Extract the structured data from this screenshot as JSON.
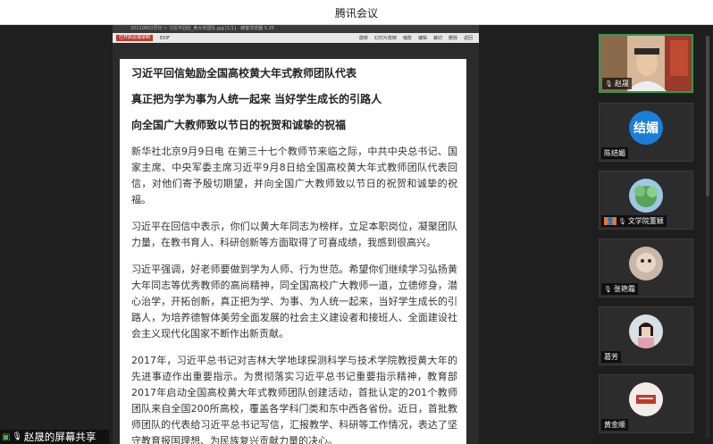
{
  "app": {
    "title": "腾讯会议"
  },
  "viewer": {
    "window_title": "20210910早日 > 习近平回信_黄大年团队.jpg [1/1] - 蜂蜜浏览器 5.35",
    "toolbar": {
      "badge": "已开启云端录制",
      "exif": "EXIF",
      "tools": [
        "旋转",
        "幻灯片放映",
        "缩放",
        "编辑",
        "裁切",
        "删除",
        "返回"
      ]
    }
  },
  "document": {
    "heading": "习近平回信勉励全国高校黄大年式教师团队代表",
    "subheading1": "真正把为学为事为人统一起来 当好学生成长的引路人",
    "subheading2": "向全国广大教师致以节日的祝贺和诚挚的祝福",
    "paragraphs": [
      "新华社北京9月9日电 在第三十七个教师节来临之际，中共中央总书记、国家主席、中央军委主席习近平9月8日给全国高校黄大年式教师团队代表回信，对他们寄予殷切期望，并向全国广大教师致以节日的祝贺和诚挚的祝福。",
      "习近平在回信中表示，你们以黄大年同志为榜样，立足本职岗位，凝聚团队力量，在教书育人、科研创新等方面取得了可喜成绩，我感到很高兴。",
      "习近平强调，好老师要做到学为人师、行为世范。希望你们继续学习弘扬黄大年同志等优秀教师的高尚精神，同全国高校广大教师一道，立德修身，潜心治学，开拓创新，真正把为学、为事、为人统一起来，当好学生成长的引路人，为培养德智体美劳全面发展的社会主义建设者和接班人、全面建设社会主义现代化国家不断作出新贡献。",
      "2017年，习近平总书记对吉林大学地球探测科学与技术学院教授黄大年的先进事迹作出重要指示。为贯彻落实习近平总书记重要指示精神，教育部2017年启动全国高校黄大年式教师团队创建活动，首批认定的201个教师团队来自全国200所高校，覆盖各学科门类和东中西各省份。近日，首批教师团队的代表给习近平总书记写信，汇报教学、科研等工作情况，表达了坚守教育报国理想、为民族复兴贡献力量的决心。"
    ]
  },
  "share_status": {
    "label": "赵晟的屏幕共享"
  },
  "participants": [
    {
      "name": "赵晟",
      "type": "video",
      "active": true
    },
    {
      "name": "陈结媚",
      "type": "initials",
      "initials": "结媚",
      "color": "#1a7fd8"
    },
    {
      "name": "文学院董颖",
      "type": "photo"
    },
    {
      "name": "张艳霜",
      "type": "photo"
    },
    {
      "name": "葛芳",
      "type": "photo"
    },
    {
      "name": "黄金顺",
      "type": "photo"
    }
  ]
}
